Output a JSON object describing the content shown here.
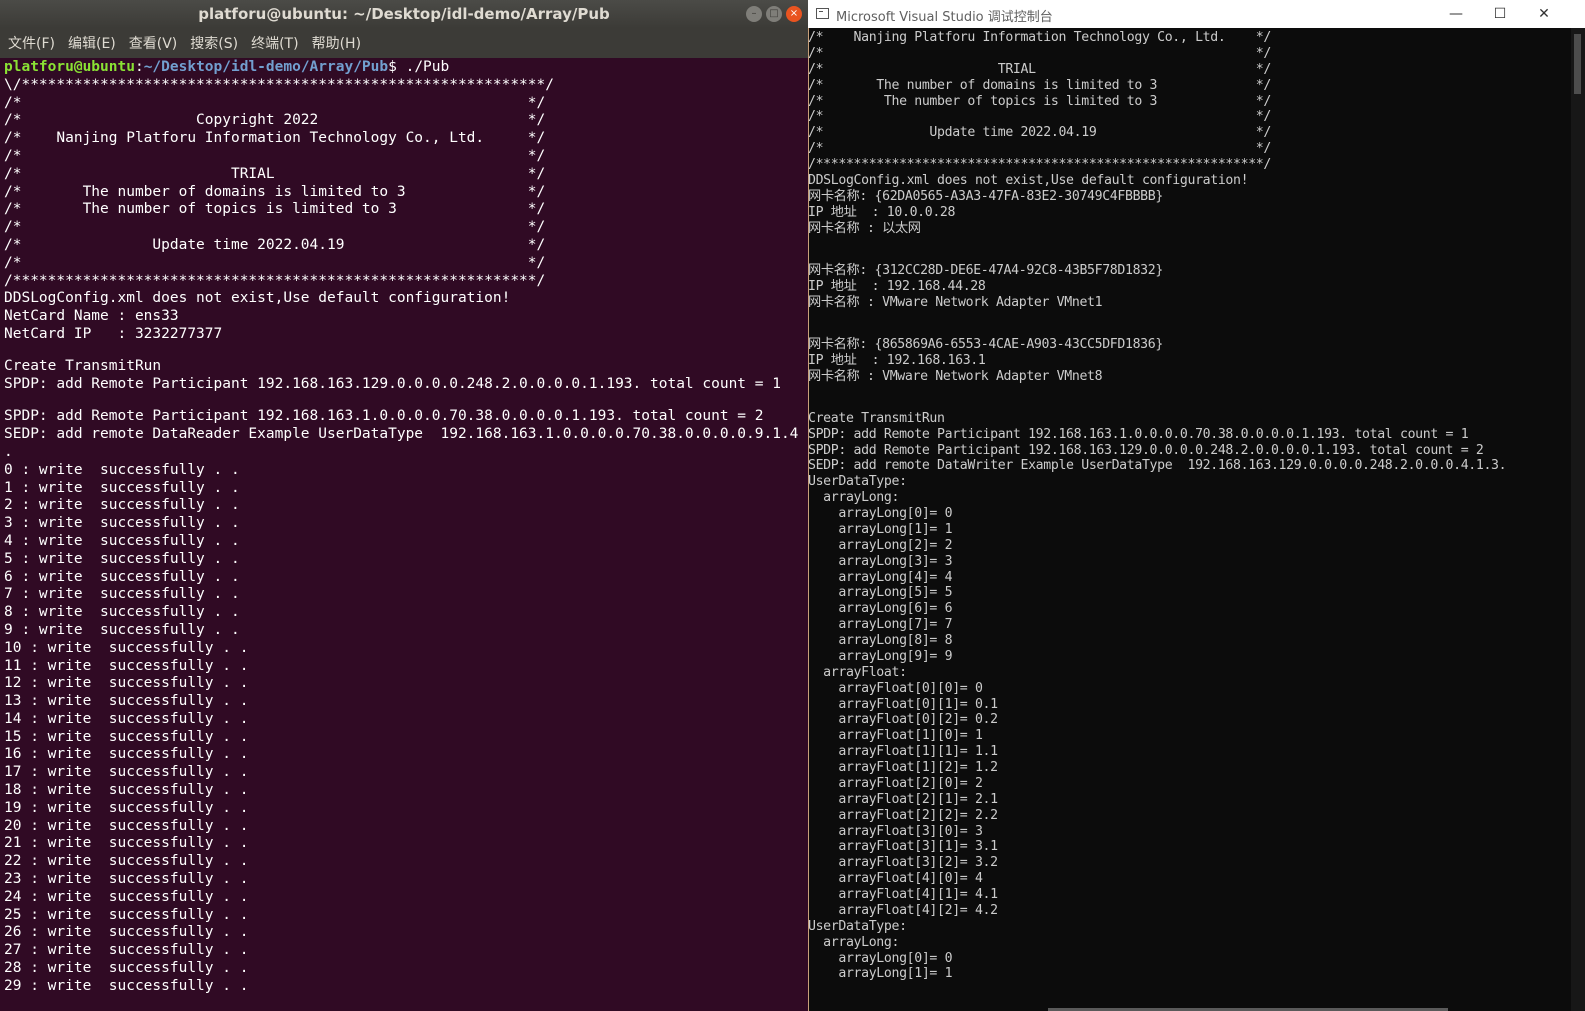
{
  "ubuntu": {
    "title": "platforu@ubuntu: ~/Desktop/idl-demo/Array/Pub",
    "buttons": {
      "minimize": "–",
      "maximize": "□",
      "close": "×"
    },
    "menu": [
      "文件(F)",
      "编辑(E)",
      "查看(V)",
      "搜索(S)",
      "终端(T)",
      "帮助(H)"
    ],
    "prompt": {
      "user": "platforu@ubuntu",
      "sep": ":",
      "path": "~/Desktop/idl-demo/Array/Pub",
      "cmd": "$ ./Pub"
    },
    "lines": [
      "\\/************************************************************/",
      "/*                                                          */",
      "/*                    Copyright 2022                        */",
      "/*    Nanjing Platforu Information Technology Co., Ltd.     */",
      "/*                                                          */",
      "/*                        TRIAL                             */",
      "/*       The number of domains is limited to 3              */",
      "/*       The number of topics is limited to 3               */",
      "/*                                                          */",
      "/*               Update time 2022.04.19                     */",
      "/*                                                          */",
      "/************************************************************/",
      "DDSLogConfig.xml does not exist,Use default configuration!",
      "NetCard Name : ens33",
      "NetCard IP   : 3232277377",
      "",
      "Create TransmitRun",
      "SPDP: add Remote Participant 192.168.163.129.0.0.0.0.248.2.0.0.0.0.1.193. total count = 1",
      "",
      "SPDP: add Remote Participant 192.168.163.1.0.0.0.0.70.38.0.0.0.0.1.193. total count = 2",
      "SEDP: add remote DataReader Example UserDataType  192.168.163.1.0.0.0.0.70.38.0.0.0.0.9.1.4",
      ".",
      "0 : write  successfully . .",
      "1 : write  successfully . .",
      "2 : write  successfully . .",
      "3 : write  successfully . .",
      "4 : write  successfully . .",
      "5 : write  successfully . .",
      "6 : write  successfully . .",
      "7 : write  successfully . .",
      "8 : write  successfully . .",
      "9 : write  successfully . .",
      "10 : write  successfully . .",
      "11 : write  successfully . .",
      "12 : write  successfully . .",
      "13 : write  successfully . .",
      "14 : write  successfully . .",
      "15 : write  successfully . .",
      "16 : write  successfully . .",
      "17 : write  successfully . .",
      "18 : write  successfully . .",
      "19 : write  successfully . .",
      "20 : write  successfully . .",
      "21 : write  successfully . .",
      "22 : write  successfully . .",
      "23 : write  successfully . .",
      "24 : write  successfully . .",
      "25 : write  successfully . .",
      "26 : write  successfully . .",
      "27 : write  successfully . .",
      "28 : write  successfully . .",
      "29 : write  successfully . ."
    ]
  },
  "vs": {
    "title": "Microsoft Visual Studio 调试控制台",
    "buttons": {
      "minimize": "—",
      "maximize": "☐",
      "close": "✕"
    },
    "lines": [
      "/*    Nanjing Platforu Information Technology Co., Ltd.    */",
      "/*                                                         */",
      "/*                       TRIAL                             */",
      "/*       The number of domains is limited to 3             */",
      "/*        The number of topics is limited to 3             */",
      "/*                                                         */",
      "/*              Update time 2022.04.19                     */",
      "/*                                                         */",
      "/***********************************************************/",
      "DDSLogConfig.xml does not exist,Use default configuration!",
      "网卡名称: {62DA0565-A3A3-47FA-83E2-30749C4FBBBB}",
      "IP 地址  : 10.0.0.28",
      "网卡名称 : 以太网",
      "",
      "",
      "网卡名称: {312CC28D-DE6E-47A4-92C8-43B5F78D1832}",
      "IP 地址  : 192.168.44.28",
      "网卡名称 : VMware Network Adapter VMnet1",
      "",
      "",
      "网卡名称: {865869A6-6553-4CAE-A903-43CC5DFD1836}",
      "IP 地址  : 192.168.163.1",
      "网卡名称 : VMware Network Adapter VMnet8",
      "",
      "",
      "Create TransmitRun",
      "SPDP: add Remote Participant 192.168.163.1.0.0.0.0.70.38.0.0.0.0.1.193. total count = 1",
      "SPDP: add Remote Participant 192.168.163.129.0.0.0.0.248.2.0.0.0.0.1.193. total count = 2",
      "SEDP: add remote DataWriter Example UserDataType  192.168.163.129.0.0.0.0.248.2.0.0.0.4.1.3.",
      "UserDataType:",
      "  arrayLong:",
      "    arrayLong[0]= 0",
      "    arrayLong[1]= 1",
      "    arrayLong[2]= 2",
      "    arrayLong[3]= 3",
      "    arrayLong[4]= 4",
      "    arrayLong[5]= 5",
      "    arrayLong[6]= 6",
      "    arrayLong[7]= 7",
      "    arrayLong[8]= 8",
      "    arrayLong[9]= 9",
      "  arrayFloat:",
      "    arrayFloat[0][0]= 0",
      "    arrayFloat[0][1]= 0.1",
      "    arrayFloat[0][2]= 0.2",
      "    arrayFloat[1][0]= 1",
      "    arrayFloat[1][1]= 1.1",
      "    arrayFloat[1][2]= 1.2",
      "    arrayFloat[2][0]= 2",
      "    arrayFloat[2][1]= 2.1",
      "    arrayFloat[2][2]= 2.2",
      "    arrayFloat[3][0]= 3",
      "    arrayFloat[3][1]= 3.1",
      "    arrayFloat[3][2]= 3.2",
      "    arrayFloat[4][0]= 4",
      "    arrayFloat[4][1]= 4.1",
      "    arrayFloat[4][2]= 4.2",
      "UserDataType:",
      "  arrayLong:",
      "    arrayLong[0]= 0",
      "    arrayLong[1]= 1"
    ]
  }
}
